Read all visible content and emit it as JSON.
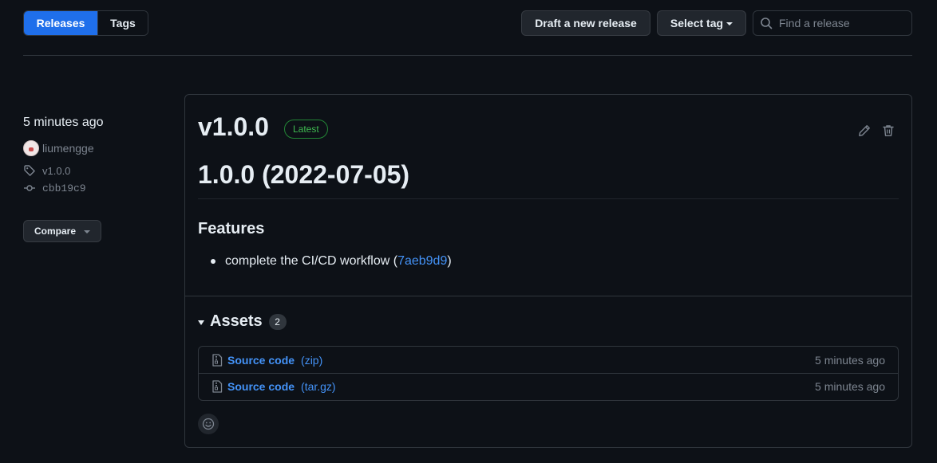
{
  "tabs": {
    "releases": "Releases",
    "tags": "Tags"
  },
  "toolbar": {
    "draft_label": "Draft a new release",
    "select_tag_label": "Select tag",
    "search_placeholder": "Find a release"
  },
  "meta": {
    "time": "5 minutes ago",
    "author": "liumengge",
    "tag": "v1.0.0",
    "commit": "cbb19c9",
    "compare_label": "Compare"
  },
  "release": {
    "title": "v1.0.0",
    "badge": "Latest",
    "heading": "1.0.0 (2022-07-05)",
    "section": "Features",
    "bullet_text": "complete the CI/CD workflow (",
    "bullet_link": "7aeb9d9",
    "bullet_end": ")"
  },
  "assets": {
    "label": "Assets",
    "count": "2",
    "items": [
      {
        "name": "Source code",
        "format": "(zip)",
        "time": "5 minutes ago"
      },
      {
        "name": "Source code",
        "format": "(tar.gz)",
        "time": "5 minutes ago"
      }
    ]
  },
  "colors": {
    "background": "#0d1117",
    "accent": "#1f6feb",
    "link": "#4493f8",
    "latest_badge": "#3fb950",
    "muted": "#7d8590"
  }
}
